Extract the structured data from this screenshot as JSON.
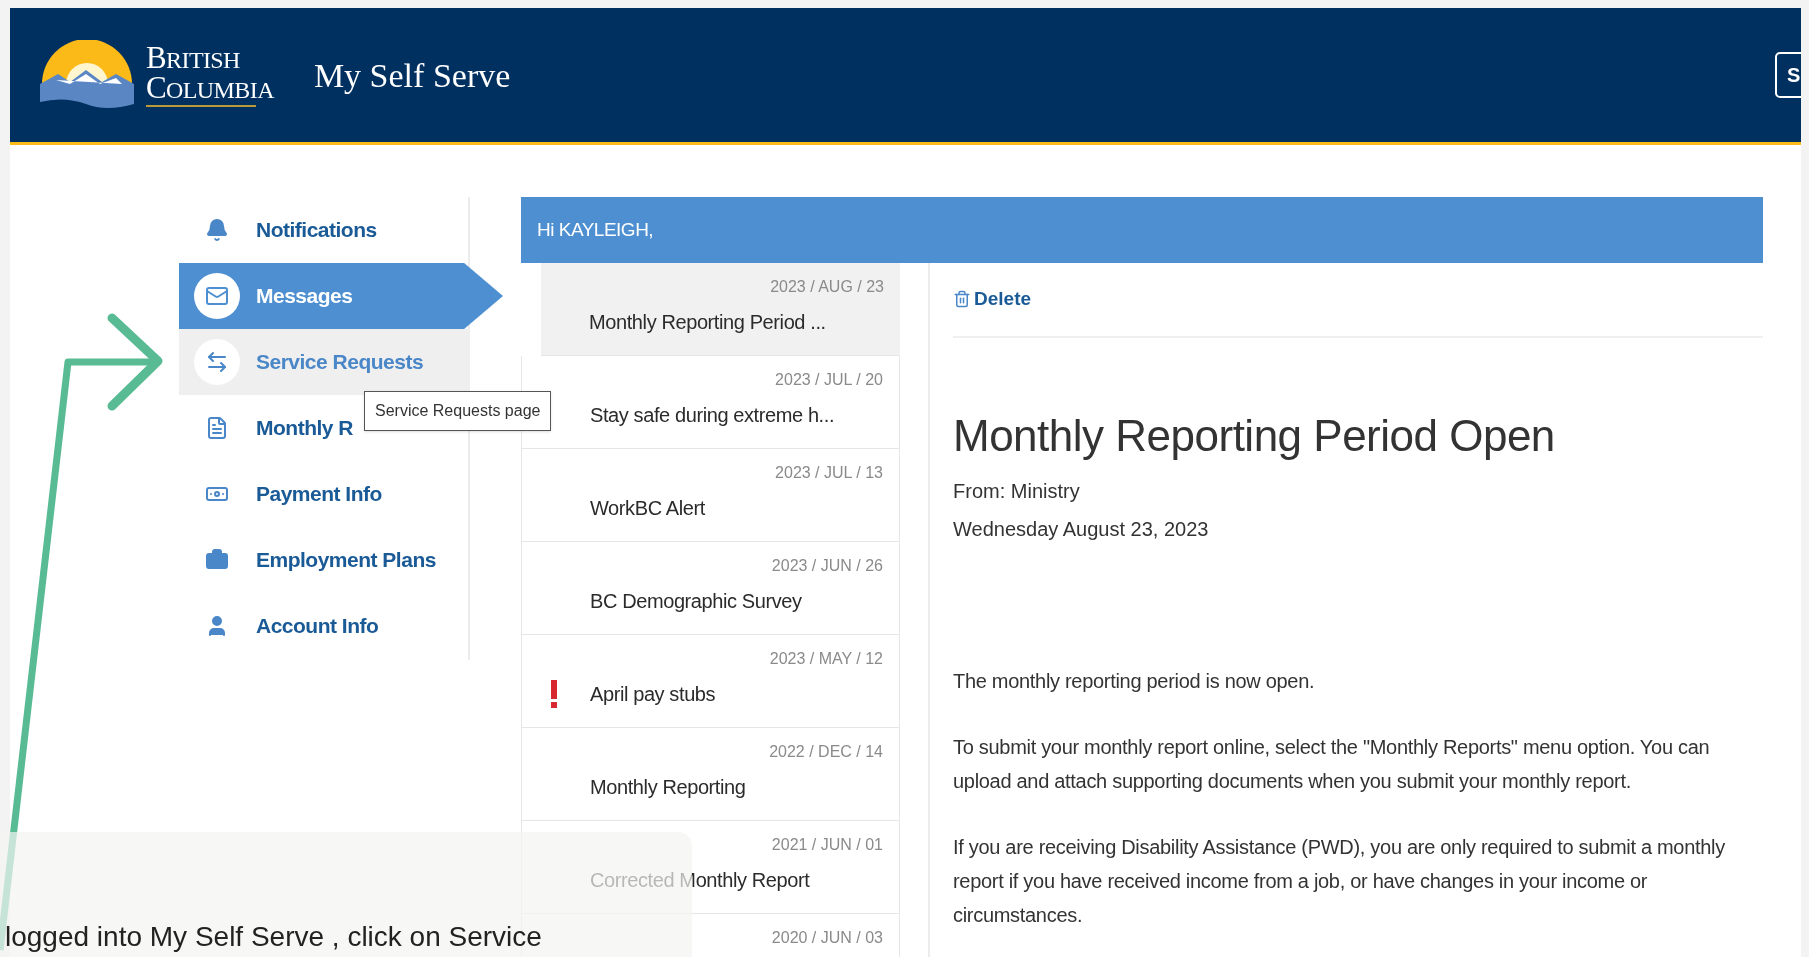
{
  "header": {
    "logo_lines": [
      "BRITISH",
      "COLUMBIA"
    ],
    "title": "My Self Serve",
    "button_label": "S"
  },
  "sidebar": {
    "items": [
      {
        "label": "Notifications",
        "selected": false,
        "hovered": false
      },
      {
        "label": "Messages",
        "selected": true,
        "hovered": false
      },
      {
        "label": "Service Requests",
        "selected": false,
        "hovered": true
      },
      {
        "label": "Monthly R",
        "selected": false,
        "hovered": false
      },
      {
        "label": "Payment Info",
        "selected": false,
        "hovered": false
      },
      {
        "label": "Employment Plans",
        "selected": false,
        "hovered": false
      },
      {
        "label": "Account Info",
        "selected": false,
        "hovered": false
      }
    ]
  },
  "tooltip": {
    "text": "Service Requests page"
  },
  "greeting": "Hi KAYLEIGH,",
  "messages": [
    {
      "date": "2023 / AUG / 23",
      "title": "Monthly Reporting Period ...",
      "selected": true,
      "urgent": false
    },
    {
      "date": "2023 / JUL / 20",
      "title": "Stay safe during extreme h...",
      "selected": false,
      "urgent": false
    },
    {
      "date": "2023 / JUL / 13",
      "title": "WorkBC Alert",
      "selected": false,
      "urgent": false
    },
    {
      "date": "2023 / JUN / 26",
      "title": "BC Demographic Survey",
      "selected": false,
      "urgent": false
    },
    {
      "date": "2023 / MAY / 12",
      "title": "April pay stubs",
      "selected": false,
      "urgent": true
    },
    {
      "date": "2022 / DEC / 14",
      "title": "Monthly Reporting",
      "selected": false,
      "urgent": false
    },
    {
      "date": "2021 / JUN / 01",
      "title": "Corrected Monthly Report",
      "selected": false,
      "urgent": false
    },
    {
      "date": "2020 / JUN / 03",
      "selected": false
    }
  ],
  "detail": {
    "action": "Delete",
    "title": "Monthly Reporting Period Open",
    "from": "From: Ministry",
    "date": "Wednesday August 23, 2023",
    "paragraphs": [
      "The monthly reporting period is now open.",
      "To submit your monthly report online, select the \"Monthly Reports\" menu option. You can upload and attach supporting documents when you submit your monthly report.",
      "If you are receiving Disability Assistance (PWD), you are only required to submit a monthly report if you have received income from a job, or have changes in your income or circumstances."
    ]
  },
  "overlay": {
    "caption": "logged into My Self Serve , click on Service"
  }
}
